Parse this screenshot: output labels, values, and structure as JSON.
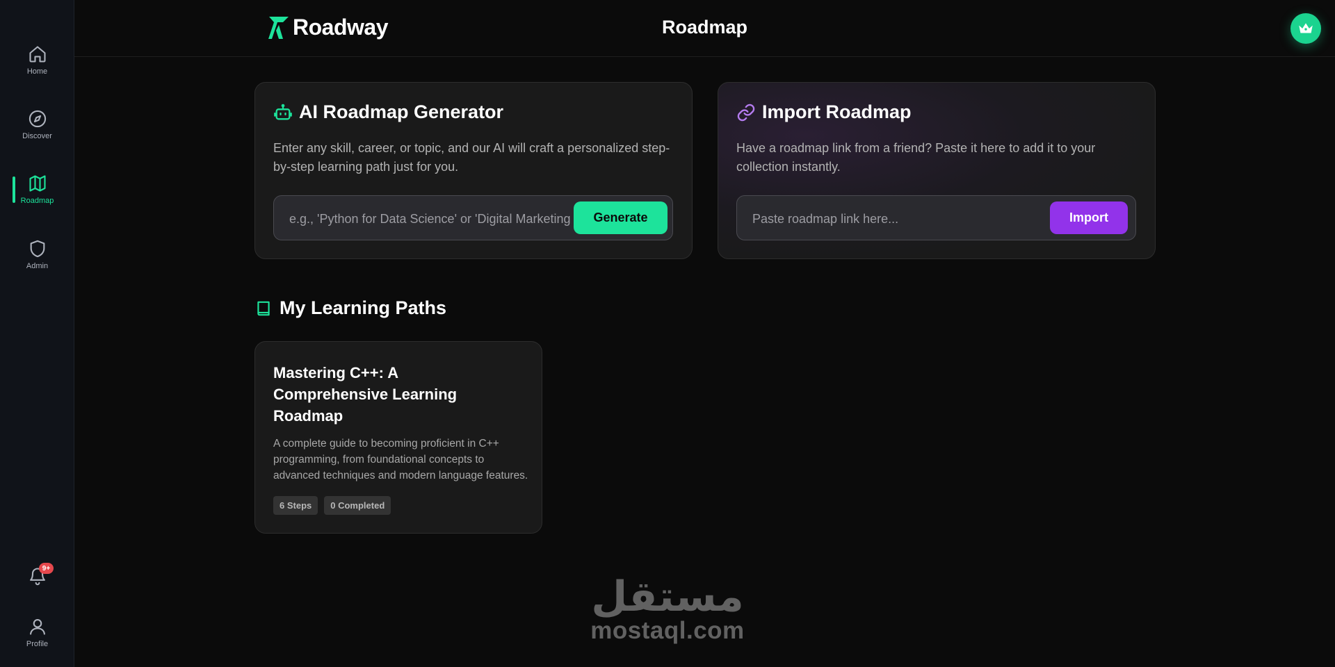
{
  "sidebar": {
    "items": [
      {
        "label": "Home",
        "icon": "home-icon"
      },
      {
        "label": "Discover",
        "icon": "compass-icon"
      },
      {
        "label": "Roadmap",
        "icon": "map-icon",
        "active": true
      },
      {
        "label": "Admin",
        "icon": "shield-icon"
      }
    ],
    "notifications": {
      "badge": "9+",
      "icon": "bell-icon"
    },
    "profile": {
      "label": "Profile",
      "icon": "user-icon"
    }
  },
  "header": {
    "brand": "Roadway",
    "title": "Roadmap",
    "premium_icon": "crown-icon"
  },
  "generator": {
    "title": "AI Roadmap Generator",
    "icon": "robot-icon",
    "description": "Enter any skill, career, or topic, and our AI will craft a personalized step-by-step learning path just for you.",
    "placeholder": "e.g., 'Python for Data Science' or 'Digital Marketing'",
    "value": "",
    "button": "Generate"
  },
  "importer": {
    "title": "Import Roadmap",
    "icon": "link-icon",
    "description": "Have a roadmap link from a friend? Paste it here to add it to your collection instantly.",
    "placeholder": "Paste roadmap link here...",
    "value": "",
    "button": "Import"
  },
  "learning_paths": {
    "title": "My Learning Paths",
    "icon": "book-icon",
    "items": [
      {
        "title": "Mastering C++: A Comprehensive Learning Roadmap",
        "description": "A complete guide to becoming proficient in C++ programming, from foundational concepts to advanced techniques and modern language features.",
        "steps": "6 Steps",
        "completed": "0 Completed"
      }
    ]
  },
  "watermark": {
    "arabic": "مستقل",
    "latin": "mostaql.com"
  },
  "colors": {
    "accent": "#1de39b",
    "import_accent": "#9233ea",
    "background": "#0b0b0b",
    "sidebar": "#101319"
  }
}
